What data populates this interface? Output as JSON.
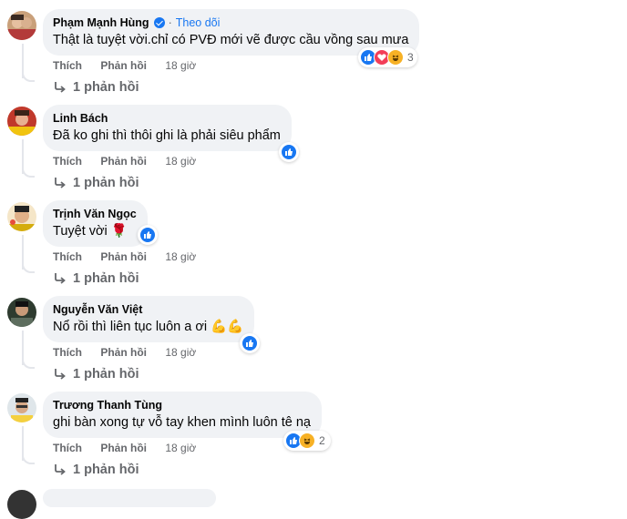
{
  "comments": [
    {
      "name": "Phạm Mạnh Hùng",
      "verified": true,
      "follow": "Theo dõi",
      "text": "Thật là tuyệt vời.chỉ có PVĐ mới vẽ được cầu vồng sau mưa",
      "like": "Thích",
      "reply": "Phản hồi",
      "time": "18 giờ",
      "replies": "1 phản hồi",
      "reaction_count": "3",
      "reactions": [
        "like",
        "love",
        "haha"
      ]
    },
    {
      "name": "Linh Bách",
      "text": "Đã ko ghi thì thôi ghi là phải siêu phẩm",
      "like": "Thích",
      "reply": "Phản hồi",
      "time": "18 giờ",
      "replies": "1 phản hồi",
      "reaction_count": "",
      "reactions": [
        "like"
      ]
    },
    {
      "name": "Trịnh Văn Ngọc",
      "text": "Tuyệt vời 🌹",
      "like": "Thích",
      "reply": "Phản hồi",
      "time": "18 giờ",
      "replies": "1 phản hồi",
      "reaction_count": "",
      "reactions": [
        "like"
      ]
    },
    {
      "name": "Nguyễn Văn Việt",
      "text": "Nổ rồi thì liên tục luôn a ơi 💪💪",
      "like": "Thích",
      "reply": "Phản hồi",
      "time": "18 giờ",
      "replies": "1 phản hồi",
      "reaction_count": "",
      "reactions": [
        "like"
      ]
    },
    {
      "name": "Trương Thanh Tùng",
      "text": "ghi bàn xong tự vỗ tay khen mình luôn tê nạ",
      "like": "Thích",
      "reply": "Phản hồi",
      "time": "18 giờ",
      "replies": "1 phản hồi",
      "reaction_count": "2",
      "reactions": [
        "like",
        "haha"
      ]
    }
  ],
  "colors": {
    "accent": "#1877f2",
    "bubble": "#f0f2f5",
    "meta": "#65676b",
    "love": "#f33e58",
    "haha": "#f7b125"
  }
}
